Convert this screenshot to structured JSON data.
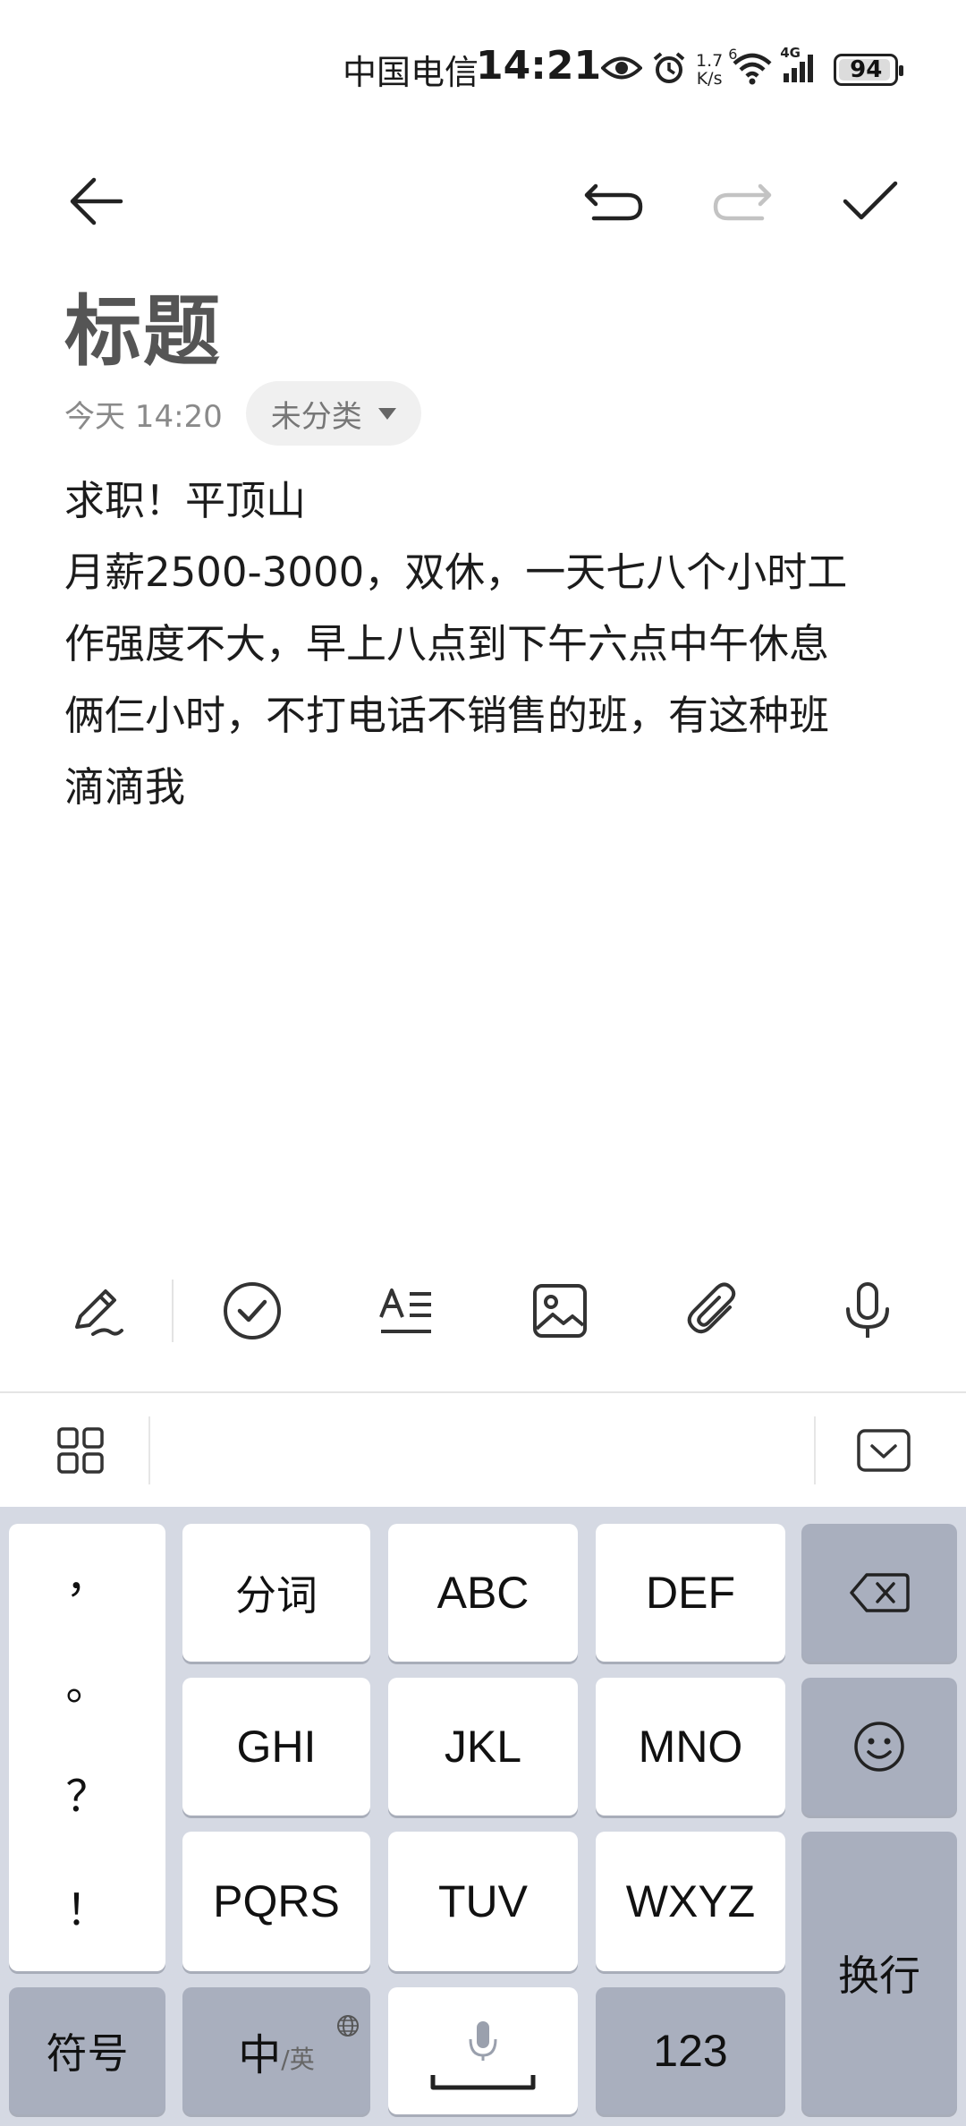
{
  "status_bar": {
    "carrier": "中国电信",
    "time": "14:21",
    "net_speed_value": "1.7",
    "net_speed_unit": "K/s",
    "wifi_badge": "6",
    "cell_badge": "4G",
    "battery": "94",
    "battery_level": 0.94,
    "icons": [
      "eye-icon",
      "alarm-icon",
      "wifi-icon",
      "cellular-signal-icon",
      "battery-icon"
    ]
  },
  "toolbar": {
    "icons": [
      "back-arrow-icon",
      "undo-icon",
      "redo-icon",
      "checkmark-icon"
    ],
    "redo_enabled": false
  },
  "note": {
    "title": "标题",
    "date": "今天 14:20",
    "category": "未分类",
    "lines": [
      "求职！平顶山",
      "月薪2500-3000，双休，一天七八个小时工",
      "作强度不大，早上八点到下午六点中午休息",
      "俩仨小时，不打电话不销售的班，有这种班",
      "滴滴我"
    ]
  },
  "format_bar": {
    "icons": [
      "handwriting-pen-icon",
      "checklist-icon",
      "text-format-icon",
      "image-icon",
      "attachment-icon",
      "microphone-icon"
    ]
  },
  "ime_bar": {
    "icons": [
      "grid-menu-icon",
      "hide-keyboard-icon"
    ]
  },
  "keyboard": {
    "punctuation": [
      "，",
      "。",
      "？",
      "！"
    ],
    "rows": [
      [
        "分词",
        "ABC",
        "DEF"
      ],
      [
        "GHI",
        "JKL",
        "MNO"
      ],
      [
        "PQRS",
        "TUV",
        "WXYZ"
      ]
    ],
    "backspace_icon": "backspace-icon",
    "emoji_icon": "emoji-icon",
    "enter": "换行",
    "symbols": "符号",
    "lang_main": "中",
    "lang_sub": "/英",
    "space_icon": "space-mic-icon",
    "numbers": "123",
    "colors": {
      "keyboard_bg": "#d5d9e3",
      "key_dark": "#a9afbe",
      "key_light": "#ffffff"
    }
  }
}
